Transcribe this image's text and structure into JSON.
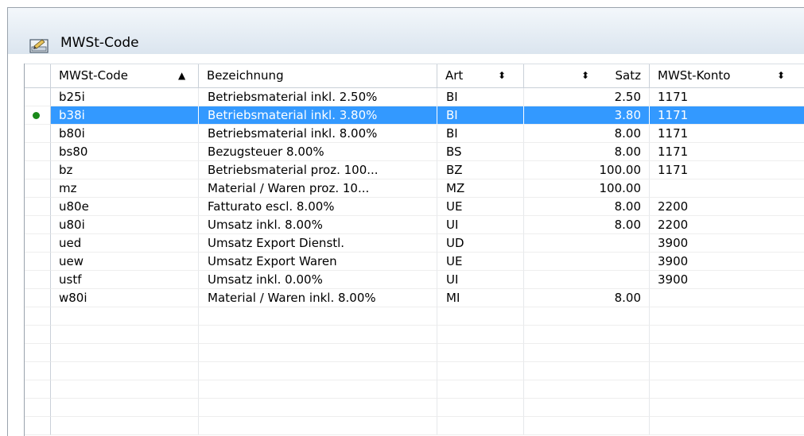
{
  "window": {
    "title": "MWSt-Code",
    "icon": "form-icon"
  },
  "table": {
    "columns": [
      {
        "key": "code",
        "label": "MWSt-Code",
        "sort": "▲",
        "sorted": "ascending"
      },
      {
        "key": "bezeichnung",
        "label": "Bezeichnung",
        "sort": ""
      },
      {
        "key": "art",
        "label": "Art",
        "sort": "⬍"
      },
      {
        "key": "satz",
        "label": "Satz",
        "sort": "⬍"
      },
      {
        "key": "konto",
        "label": "MWSt-Konto",
        "sort": "⬍"
      }
    ],
    "selected_row": 1,
    "rows": [
      {
        "code": "b25i",
        "bezeichnung": "Betriebsmaterial inkl. 2.50%",
        "art": "BI",
        "satz": "2.50",
        "konto": "1171"
      },
      {
        "code": "b38i",
        "bezeichnung": "Betriebsmaterial inkl. 3.80%",
        "art": "BI",
        "satz": "3.80",
        "konto": "1171"
      },
      {
        "code": "b80i",
        "bezeichnung": "Betriebsmaterial inkl. 8.00%",
        "art": "BI",
        "satz": "8.00",
        "konto": "1171"
      },
      {
        "code": "bs80",
        "bezeichnung": "Bezugsteuer 8.00%",
        "art": "BS",
        "satz": "8.00",
        "konto": "1171"
      },
      {
        "code": "bz",
        "bezeichnung": "Betriebsmaterial proz. 100...",
        "art": "BZ",
        "satz": "100.00",
        "konto": "1171"
      },
      {
        "code": "mz",
        "bezeichnung": "Material / Waren proz. 10...",
        "art": "MZ",
        "satz": "100.00",
        "konto": ""
      },
      {
        "code": "u80e",
        "bezeichnung": "Fatturato escl. 8.00%",
        "art": "UE",
        "satz": "8.00",
        "konto": "2200"
      },
      {
        "code": "u80i",
        "bezeichnung": "Umsatz inkl. 8.00%",
        "art": "UI",
        "satz": "8.00",
        "konto": "2200"
      },
      {
        "code": "ued",
        "bezeichnung": "Umsatz Export Dienstl.",
        "art": "UD",
        "satz": "",
        "konto": "3900"
      },
      {
        "code": "uew",
        "bezeichnung": "Umsatz Export Waren",
        "art": "UE",
        "satz": "",
        "konto": "3900"
      },
      {
        "code": "ustf",
        "bezeichnung": "Umsatz inkl. 0.00%",
        "art": "UI",
        "satz": "",
        "konto": "3900"
      },
      {
        "code": "w80i",
        "bezeichnung": "Material / Waren inkl. 8.00%",
        "art": "MI",
        "satz": "8.00",
        "konto": ""
      },
      {
        "code": "",
        "bezeichnung": "",
        "art": "",
        "satz": "",
        "konto": ""
      },
      {
        "code": "",
        "bezeichnung": "",
        "art": "",
        "satz": "",
        "konto": ""
      },
      {
        "code": "",
        "bezeichnung": "",
        "art": "",
        "satz": "",
        "konto": ""
      },
      {
        "code": "",
        "bezeichnung": "",
        "art": "",
        "satz": "",
        "konto": ""
      },
      {
        "code": "",
        "bezeichnung": "",
        "art": "",
        "satz": "",
        "konto": ""
      },
      {
        "code": "",
        "bezeichnung": "",
        "art": "",
        "satz": "",
        "konto": ""
      },
      {
        "code": "",
        "bezeichnung": "",
        "art": "",
        "satz": "",
        "konto": ""
      }
    ]
  },
  "colors": {
    "selection": "#3399ff",
    "active_indicator": "#1a8a1a"
  }
}
